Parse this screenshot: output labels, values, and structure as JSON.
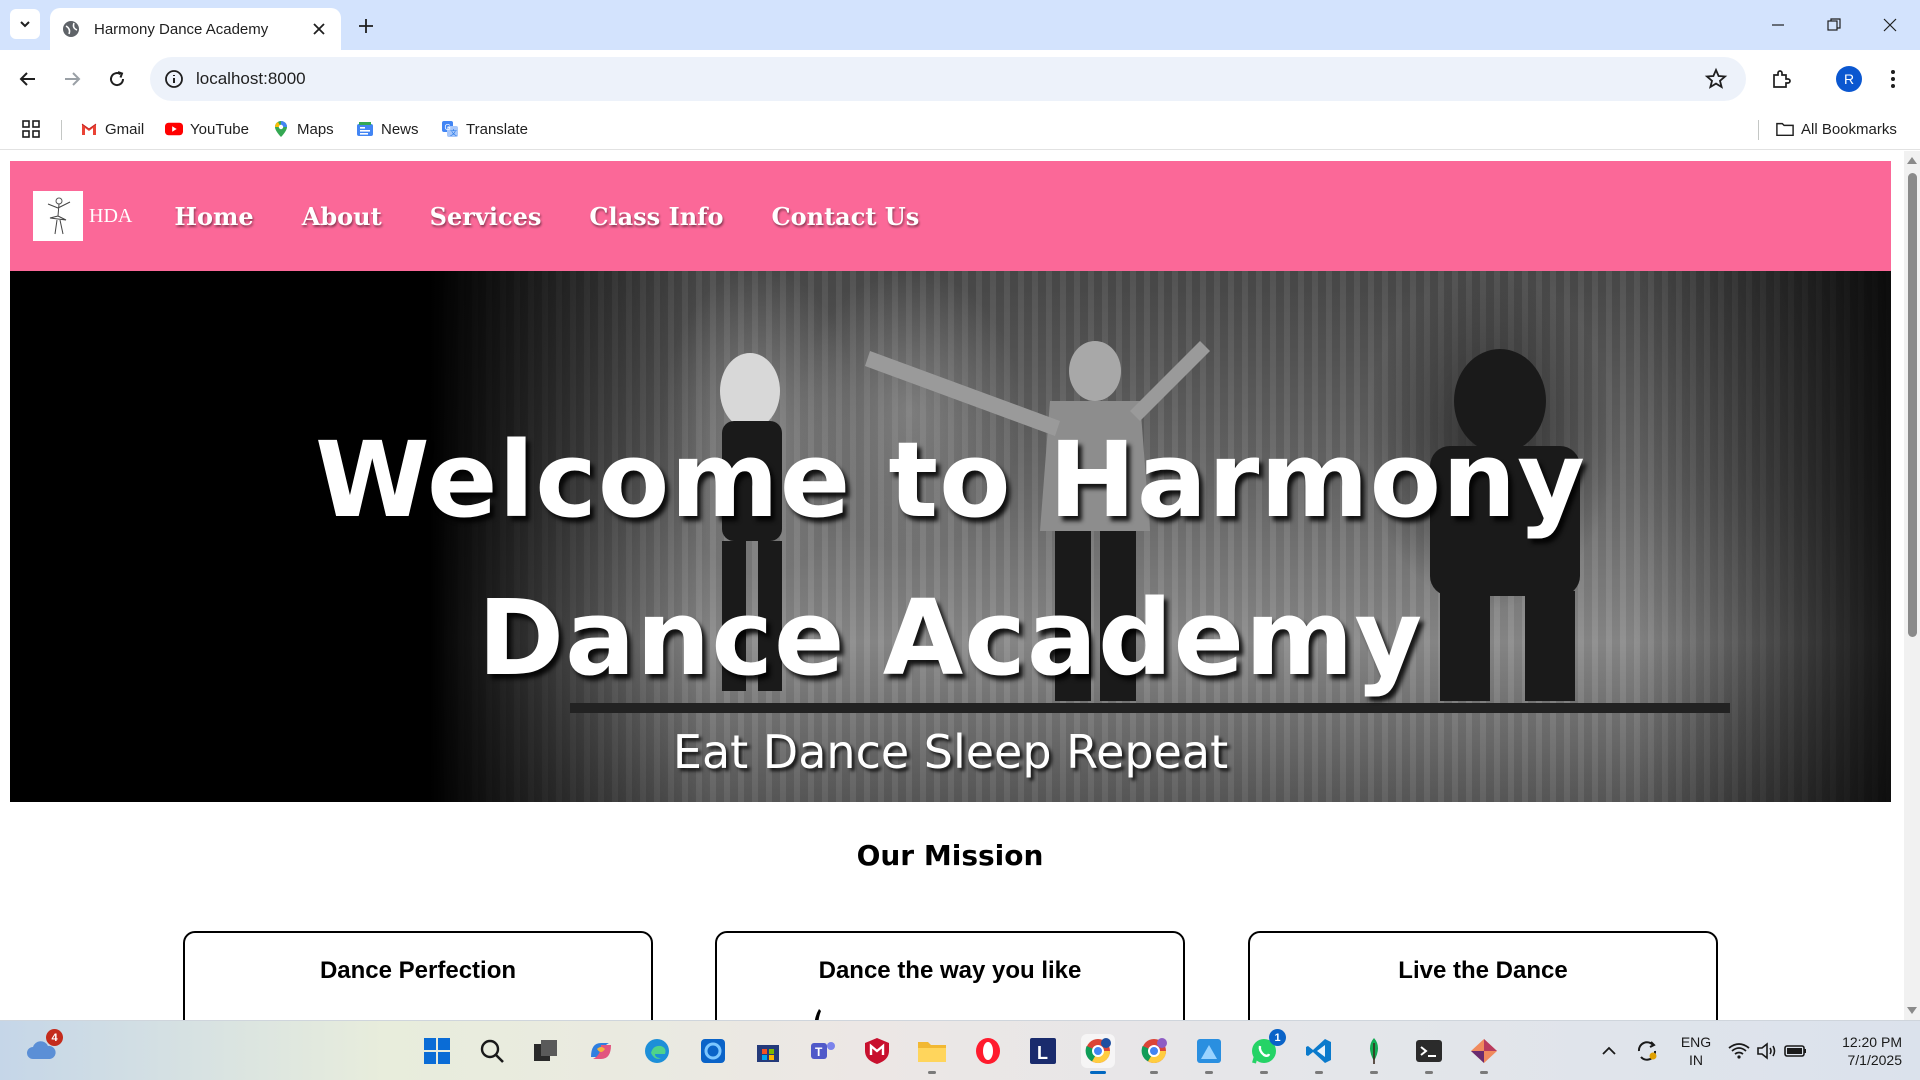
{
  "browser": {
    "tab": {
      "title": "Harmony Dance Academy"
    },
    "address_bar": {
      "url": "localhost:8000"
    },
    "profile_initial": "R",
    "bookmarks": [
      {
        "label": "Gmail",
        "icon": "gmail-icon"
      },
      {
        "label": "YouTube",
        "icon": "youtube-icon"
      },
      {
        "label": "Maps",
        "icon": "maps-icon"
      },
      {
        "label": "News",
        "icon": "news-icon"
      },
      {
        "label": "Translate",
        "icon": "translate-icon"
      }
    ],
    "all_bookmarks_label": "All Bookmarks"
  },
  "site": {
    "logo_text": "HDA",
    "nav": [
      "Home",
      "About",
      "Services",
      "Class Info",
      "Contact Us"
    ],
    "colors": {
      "nav_background": "#fb6898"
    },
    "hero": {
      "title": "Welcome to Harmony Dance Academy",
      "tagline": "Eat Dance Sleep Repeat"
    },
    "mission": {
      "heading": "Our Mission",
      "cards": [
        {
          "title": "Dance Perfection"
        },
        {
          "title": "Dance the way you like"
        },
        {
          "title": "Live the Dance"
        }
      ]
    }
  },
  "taskbar": {
    "notification_badge": "4",
    "whatsapp_badge": "1",
    "language": {
      "line1": "ENG",
      "line2": "IN"
    },
    "clock": {
      "time": "12:20 PM",
      "date": "7/1/2025"
    }
  }
}
